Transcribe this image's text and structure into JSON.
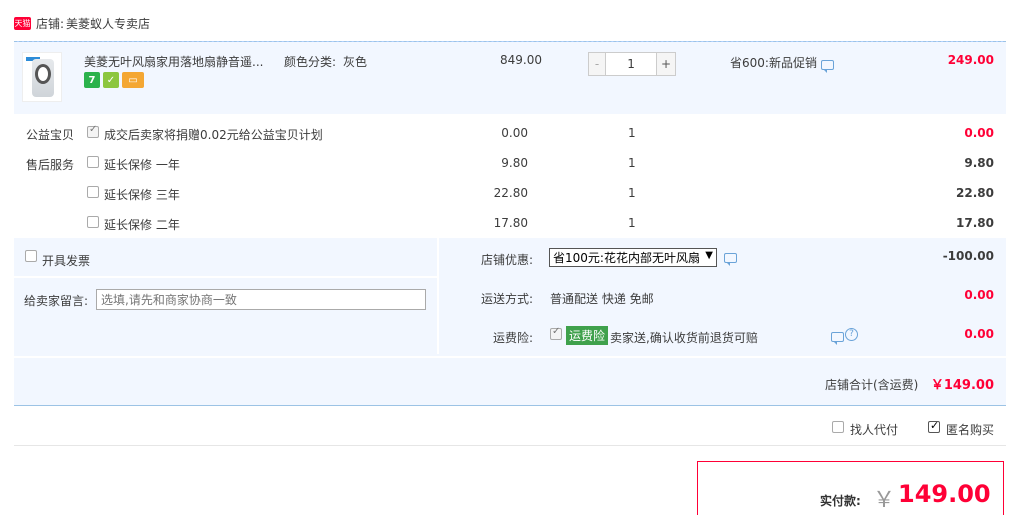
{
  "shop": {
    "badge": "天猫",
    "label": "店铺:",
    "name": "美菱蚁人专卖店"
  },
  "item": {
    "title": "美菱无叶风扇家用落地扇静音遥...",
    "spec_label": "颜色分类:",
    "spec_value": "灰色",
    "price": "849.00",
    "qty_minus": "-",
    "qty": "1",
    "qty_plus": "+",
    "promo": "省600:新品促销",
    "total": "249.00",
    "icons": [
      "7-day-return-icon",
      "authentic-icon",
      "credit-card-icon"
    ],
    "icon_glyphs": [
      "7",
      "✓",
      "▭"
    ]
  },
  "services": {
    "charity_title": "公益宝贝",
    "aftersale_title": "售后服务",
    "rows": [
      {
        "desc": "成交后卖家将捐赠0.02元给公益宝贝计划",
        "price": "0.00",
        "qty": "1",
        "total": "0.00",
        "checked": true
      },
      {
        "desc": "延长保修 一年",
        "price": "9.80",
        "qty": "1",
        "total": "9.80",
        "checked": false
      },
      {
        "desc": "延长保修 三年",
        "price": "22.80",
        "qty": "1",
        "total": "22.80",
        "checked": false
      },
      {
        "desc": "延长保修 二年",
        "price": "17.80",
        "qty": "1",
        "total": "17.80",
        "checked": false
      }
    ]
  },
  "invoice": {
    "label": "开具发票"
  },
  "message": {
    "label": "给卖家留言:",
    "placeholder": "选填,请先和商家协商一致"
  },
  "discount": {
    "label": "店铺优惠:",
    "selected": "省100元:花花内部无叶风扇",
    "total": "-100.00"
  },
  "shipping": {
    "label": "运送方式:",
    "value": "普通配送 快递 免邮",
    "total": "0.00"
  },
  "insurance": {
    "label": "运费险:",
    "badge": "运费险",
    "desc": "卖家送,确认收货前退货可赔",
    "total": "0.00",
    "help": "?"
  },
  "subtotal": {
    "label": "店铺合计(含运费)",
    "value": "￥149.00"
  },
  "options": {
    "agent_pay": "找人代付",
    "anonymous": "匿名购买"
  },
  "payment": {
    "label": "实付款:",
    "currency": "￥",
    "value": "149.00"
  },
  "colors": {
    "accent": "#ff0036",
    "panel": "#f2f7ff",
    "border": "#9cc3e5"
  }
}
